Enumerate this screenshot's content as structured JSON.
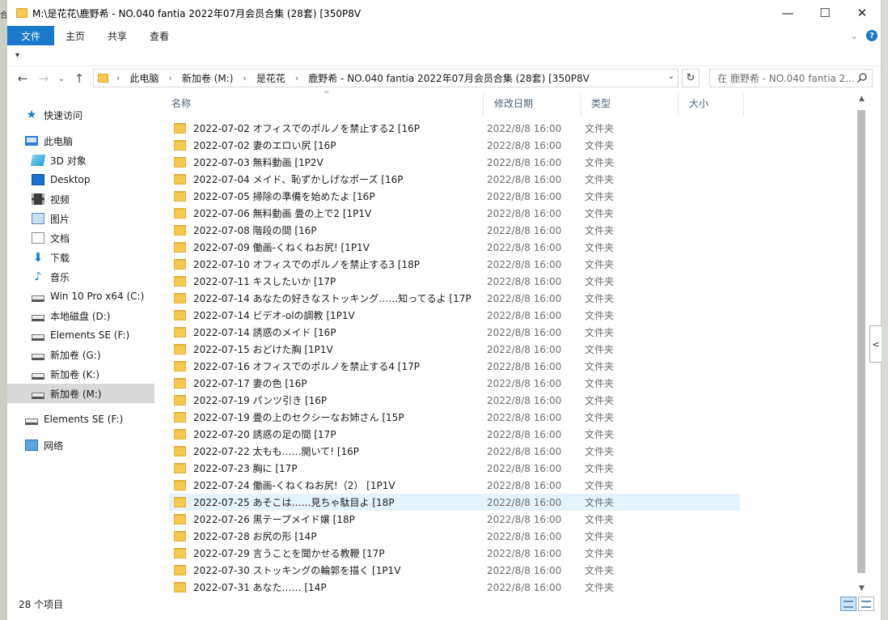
{
  "window": {
    "title": "M:\\是花花\\鹿野希 - NO.040 fantia 2022年07月会员合集 (28套) [350P8V",
    "minimize": "—",
    "maximize": "☐",
    "close": "✕"
  },
  "ribbon": {
    "tabs": [
      "文件",
      "主页",
      "共享",
      "查看"
    ],
    "expand": "⌄",
    "help": "?"
  },
  "qat": {
    "customize": "▾"
  },
  "nav": {
    "back": "←",
    "forward": "→",
    "recent": "⌄",
    "up": "↑",
    "breadcrumbs": [
      "此电脑",
      "新加卷 (M:)",
      "是花花",
      "鹿野希 - NO.040 fantia 2022年07月会员合集 (28套) [350P8V"
    ],
    "crumb_sep": "›",
    "dropdown": "⌄",
    "refresh": "↻",
    "search_placeholder": "在 鹿野希 - NO.040 fantia 2..."
  },
  "sidebar": {
    "items": [
      {
        "label": "快速访问",
        "icon": "star-icon"
      },
      {
        "label": "此电脑",
        "icon": "computer-icon"
      },
      {
        "label": "3D 对象",
        "icon": "3d-objects-icon"
      },
      {
        "label": "Desktop",
        "icon": "desktop-icon"
      },
      {
        "label": "视频",
        "icon": "video-icon"
      },
      {
        "label": "图片",
        "icon": "pictures-icon"
      },
      {
        "label": "文档",
        "icon": "documents-icon"
      },
      {
        "label": "下载",
        "icon": "download-icon"
      },
      {
        "label": "音乐",
        "icon": "music-icon"
      },
      {
        "label": "Win 10 Pro x64 (C:)",
        "icon": "windows-drive-icon"
      },
      {
        "label": "本地磁盘 (D:)",
        "icon": "drive-icon"
      },
      {
        "label": "Elements SE (F:)",
        "icon": "drive-icon"
      },
      {
        "label": "新加卷 (G:)",
        "icon": "drive-icon"
      },
      {
        "label": "新加卷 (K:)",
        "icon": "drive-icon"
      },
      {
        "label": "新加卷 (M:)",
        "icon": "drive-icon"
      },
      {
        "label": "Elements SE (F:)",
        "icon": "drive-icon"
      },
      {
        "label": "网络",
        "icon": "network-icon"
      }
    ]
  },
  "columns": {
    "name": "名称",
    "modified": "修改日期",
    "type": "类型",
    "size": "大小",
    "sort_indicator": "^"
  },
  "files": [
    {
      "name": "2022-07-02 オフィスでのポルノを禁止する2 [16P",
      "date": "2022/8/8 16:00",
      "type": "文件夹"
    },
    {
      "name": "2022-07-02 妻のエロい尻 [16P",
      "date": "2022/8/8 16:00",
      "type": "文件夹"
    },
    {
      "name": "2022-07-03 無料動画 [1P2V",
      "date": "2022/8/8 16:00",
      "type": "文件夹"
    },
    {
      "name": "2022-07-04 メイド、恥ずかしげなポーズ [16P",
      "date": "2022/8/8 16:00",
      "type": "文件夹"
    },
    {
      "name": "2022-07-05 掃除の準備を始めたよ [16P",
      "date": "2022/8/8 16:00",
      "type": "文件夹"
    },
    {
      "name": "2022-07-06 無料動画 畳の上で2 [1P1V",
      "date": "2022/8/8 16:00",
      "type": "文件夹"
    },
    {
      "name": "2022-07-08 階段の間 [16P",
      "date": "2022/8/8 16:00",
      "type": "文件夹"
    },
    {
      "name": "2022-07-09 働画-くねくねお尻! [1P1V",
      "date": "2022/8/8 16:00",
      "type": "文件夹"
    },
    {
      "name": "2022-07-10 オフィスでのポルノを禁止する3 [18P",
      "date": "2022/8/8 16:00",
      "type": "文件夹"
    },
    {
      "name": "2022-07-11 キスしたいか [17P",
      "date": "2022/8/8 16:00",
      "type": "文件夹"
    },
    {
      "name": "2022-07-14 あなたの好きなストッキング……知ってるよ [17P",
      "date": "2022/8/8 16:00",
      "type": "文件夹"
    },
    {
      "name": "2022-07-14 ビデオ-olの調教 [1P1V",
      "date": "2022/8/8 16:00",
      "type": "文件夹"
    },
    {
      "name": "2022-07-14 誘惑のメイド [16P",
      "date": "2022/8/8 16:00",
      "type": "文件夹"
    },
    {
      "name": "2022-07-15 おどけた胸 [1P1V",
      "date": "2022/8/8 16:00",
      "type": "文件夹"
    },
    {
      "name": "2022-07-16 オフィスでのポルノを禁止する4 [17P",
      "date": "2022/8/8 16:00",
      "type": "文件夹"
    },
    {
      "name": "2022-07-17 妻の色 [16P",
      "date": "2022/8/8 16:00",
      "type": "文件夹"
    },
    {
      "name": "2022-07-19 パンツ引き [16P",
      "date": "2022/8/8 16:00",
      "type": "文件夹"
    },
    {
      "name": "2022-07-19 畳の上のセクシーなお姉さん [15P",
      "date": "2022/8/8 16:00",
      "type": "文件夹"
    },
    {
      "name": "2022-07-20 誘惑の足の間 [17P",
      "date": "2022/8/8 16:00",
      "type": "文件夹"
    },
    {
      "name": "2022-07-22 太もも……開いて! [16P",
      "date": "2022/8/8 16:00",
      "type": "文件夹"
    },
    {
      "name": "2022-07-23 胸に [17P",
      "date": "2022/8/8 16:00",
      "type": "文件夹"
    },
    {
      "name": "2022-07-24 働画-くねくねお尻!（2） [1P1V",
      "date": "2022/8/8 16:00",
      "type": "文件夹"
    },
    {
      "name": "2022-07-25 あそこは……見ちゃ駄目よ [18P",
      "date": "2022/8/8 16:00",
      "type": "文件夹"
    },
    {
      "name": "2022-07-26 黒テープメイド嬢 [18P",
      "date": "2022/8/8 16:00",
      "type": "文件夹"
    },
    {
      "name": "2022-07-28 お尻の形 [14P",
      "date": "2022/8/8 16:00",
      "type": "文件夹"
    },
    {
      "name": "2022-07-29 言うことを聞かせる教鞭 [17P",
      "date": "2022/8/8 16:00",
      "type": "文件夹"
    },
    {
      "name": "2022-07-30 ストッキングの輪郭を描く [1P1V",
      "date": "2022/8/8 16:00",
      "type": "文件夹"
    },
    {
      "name": "2022-07-31 あなた…… [14P",
      "date": "2022/8/8 16:00",
      "type": "文件夹"
    }
  ],
  "scroll": {
    "up": "▲",
    "down": "▼",
    "side_tab": "<"
  },
  "status": {
    "count": "28 个项目"
  },
  "background": {
    "edge_char": "合"
  }
}
